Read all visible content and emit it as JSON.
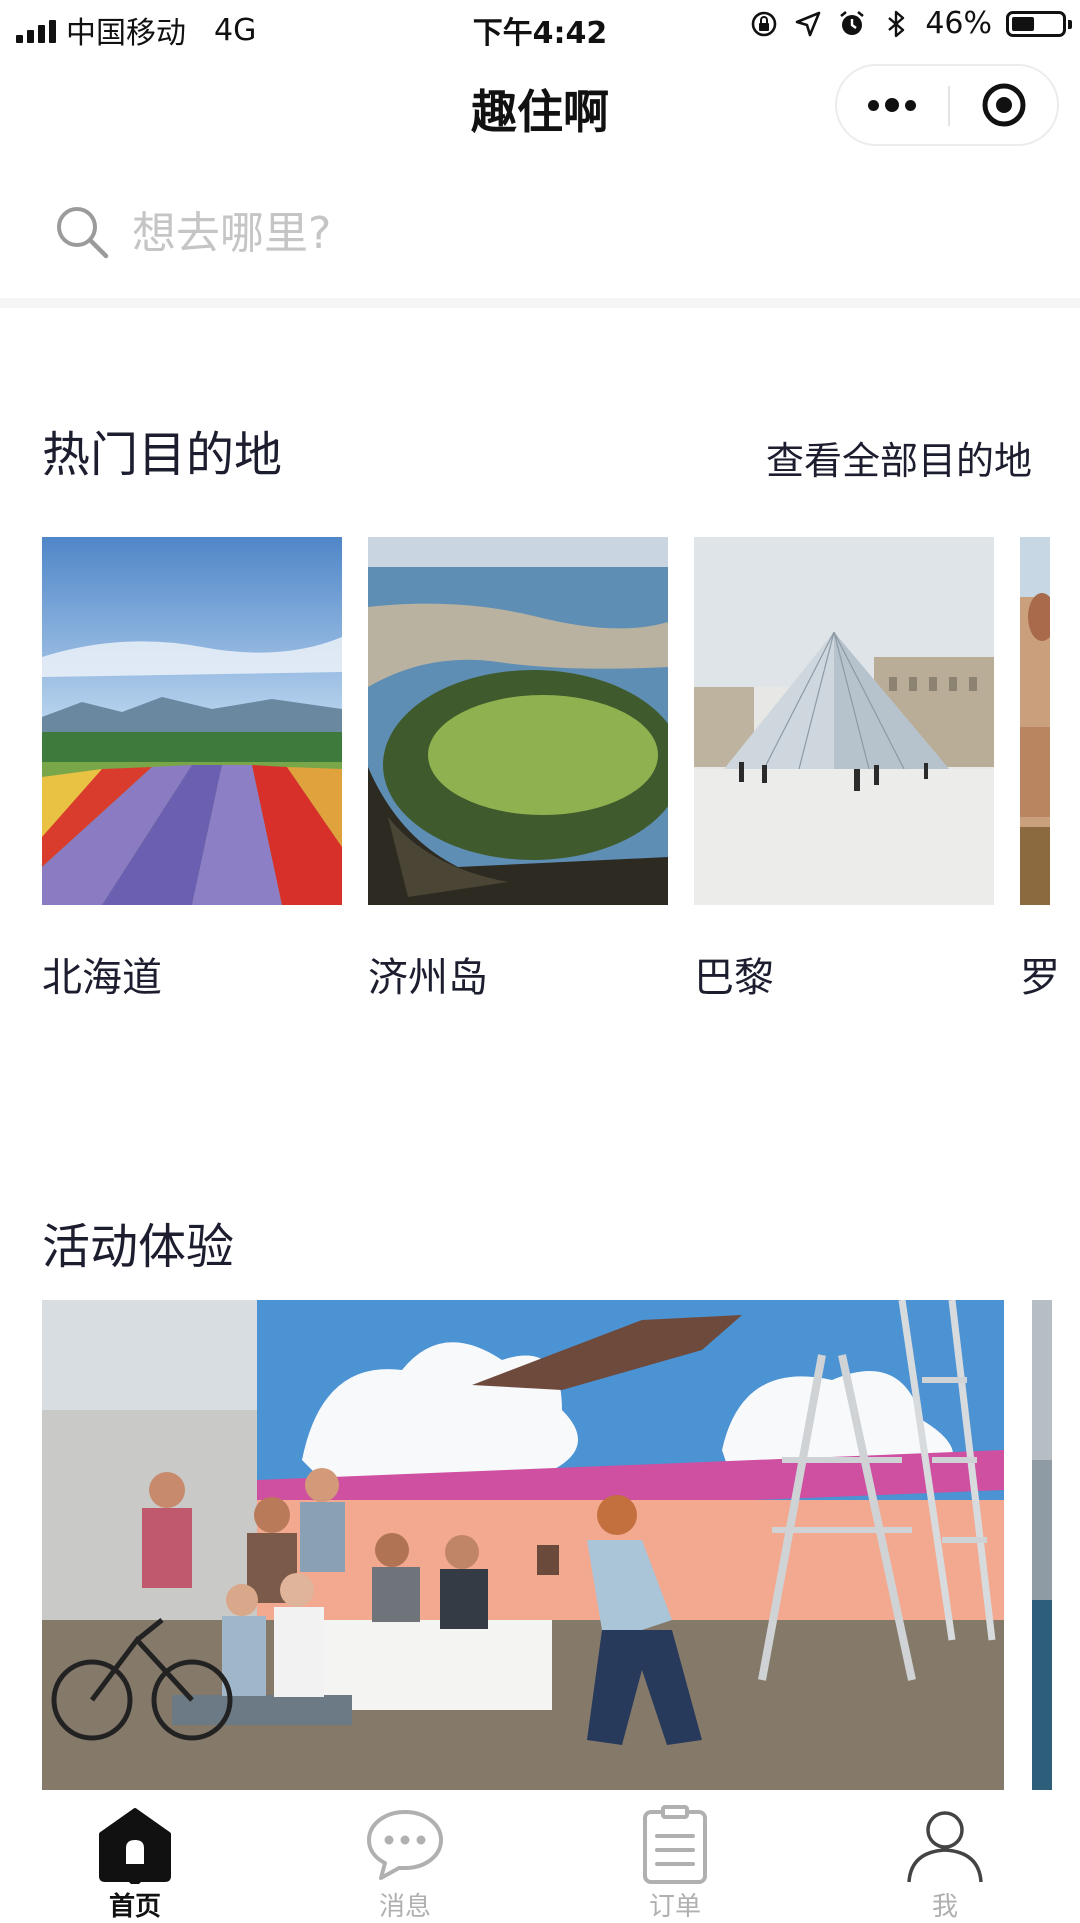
{
  "status_bar": {
    "carrier": "中国移动",
    "network": "4G",
    "time": "下午4:42",
    "battery_text": "46%",
    "battery_level": 0.46
  },
  "nav": {
    "title": "趣住啊"
  },
  "search": {
    "placeholder": "想去哪里?"
  },
  "destinations": {
    "title": "热门目的地",
    "see_all": "查看全部目的地",
    "items": [
      {
        "name": "北海道"
      },
      {
        "name": "济州岛"
      },
      {
        "name": "巴黎"
      },
      {
        "name": "罗"
      }
    ]
  },
  "experiences": {
    "title": "活动体验"
  },
  "tabbar": {
    "items": [
      {
        "label": "首页",
        "icon": "home-icon",
        "active": true
      },
      {
        "label": "消息",
        "icon": "chat-icon",
        "active": false
      },
      {
        "label": "订单",
        "icon": "order-icon",
        "active": false
      },
      {
        "label": "我",
        "icon": "user-icon",
        "active": false
      }
    ]
  },
  "colors": {
    "text": "#1c1d2e",
    "inactive": "#b0b0b0",
    "placeholder": "#c5c5c5"
  }
}
